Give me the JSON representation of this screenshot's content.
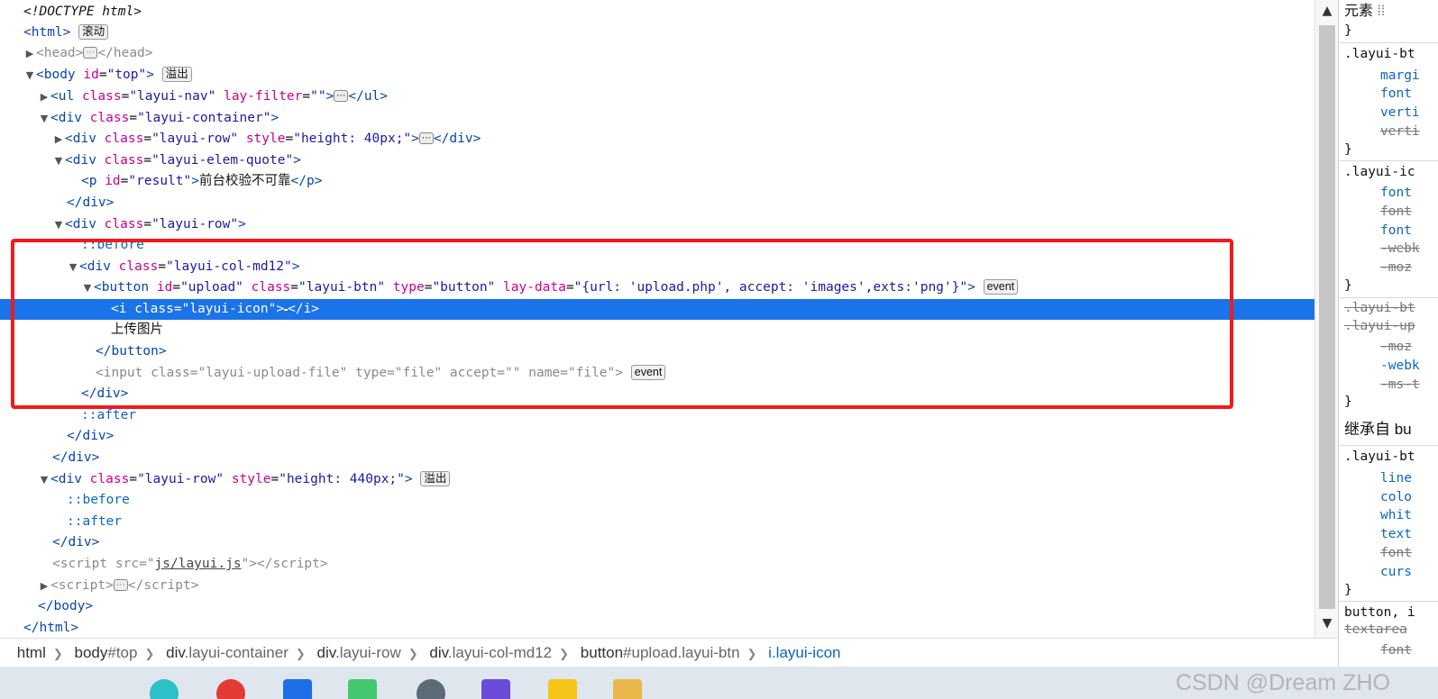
{
  "badges": {
    "scroll": "滚动",
    "overflow": "溢出",
    "event": "event",
    "ellipsis": "⋯"
  },
  "dom": {
    "l1": {
      "text": "<!DOCTYPE html>"
    },
    "l2": {
      "tag": "html"
    },
    "l3": {
      "open": "head",
      "close": "head"
    },
    "l4": {
      "tag": "body",
      "attr": "id",
      "val": "\"top\""
    },
    "l5": {
      "tag": "ul",
      "a1": "class",
      "v1": "\"layui-nav\"",
      "a2": "lay-filter",
      "v2": "\"\"",
      "close": "ul"
    },
    "l6": {
      "tag": "div",
      "a1": "class",
      "v1": "\"layui-container\""
    },
    "l7": {
      "tag": "div",
      "a1": "class",
      "v1": "\"layui-row\"",
      "a2": "style",
      "v2": "\"height: 40px;\"",
      "close": "div"
    },
    "l8": {
      "tag": "div",
      "a1": "class",
      "v1": "\"layui-elem-quote\""
    },
    "l9": {
      "tag": "p",
      "a1": "id",
      "v1": "\"result\"",
      "text": "前台校验不可靠",
      "close": "p"
    },
    "l10": {
      "close": "div"
    },
    "l11": {
      "tag": "div",
      "a1": "class",
      "v1": "\"layui-row\""
    },
    "l12": {
      "text": "::before"
    },
    "l13": {
      "tag": "div",
      "a1": "class",
      "v1": "\"layui-col-md12\""
    },
    "l14": {
      "tag": "button",
      "a1": "id",
      "v1": "\"upload\"",
      "a2": "class",
      "v2": "\"layui-btn\"",
      "a3": "type",
      "v3": "\"button\"",
      "a4": "lay-data",
      "v4": "\"{url: 'upload.php', accept: 'images',exts:'png'}\""
    },
    "l15": {
      "tag": "i",
      "a1": "class",
      "v1": "\"layui-icon\"",
      "glyph": "",
      "close": "i"
    },
    "l16": {
      "text": "上传图片"
    },
    "l17": {
      "close": "button"
    },
    "l18": {
      "tag": "input",
      "a1": "class",
      "v1": "\"layui-upload-file\"",
      "a2": "type",
      "v2": "\"file\"",
      "a3": "accept",
      "v3": "\"\"",
      "a4": "name",
      "v4": "\"file\""
    },
    "l19": {
      "close": "div"
    },
    "l20": {
      "text": "::after"
    },
    "l21": {
      "close": "div"
    },
    "l22": {
      "close": "div"
    },
    "l23": {
      "tag": "div",
      "a1": "class",
      "v1": "\"layui-row\"",
      "a2": "style",
      "v2": "\"height: 440px;\""
    },
    "l24": {
      "text": "::before"
    },
    "l25": {
      "text": "::after"
    },
    "l26": {
      "close": "div"
    },
    "l27": {
      "tag": "script",
      "a1": "src",
      "v1": "js/layui.js",
      "close": "script"
    },
    "l28": {
      "open": "script",
      "close": "script"
    },
    "l29": {
      "close": "body"
    },
    "l30": {
      "close": "html"
    }
  },
  "styles_panel": {
    "tab": "元素",
    "lines": [
      "}",
      ".layui-bt",
      "margi",
      "font",
      "verti",
      "verti",
      "}",
      ".layui-ic",
      "font",
      "font",
      "font",
      "-webk",
      "-moz",
      "}",
      ".layui-bt",
      ".layui-up",
      "-moz",
      "-webk",
      "-ms-t",
      "}",
      "继承自 bu",
      ".layui-bt",
      "line",
      "colo",
      "whit",
      "text",
      "font",
      "curs",
      "}",
      "button, i",
      "textarea",
      "font"
    ]
  },
  "breadcrumbs": [
    {
      "tag": "html",
      "cls": ""
    },
    {
      "tag": "body",
      "cls": "#top"
    },
    {
      "tag": "div",
      "cls": ".layui-container"
    },
    {
      "tag": "div",
      "cls": ".layui-row"
    },
    {
      "tag": "div",
      "cls": ".layui-col-md12"
    },
    {
      "tag": "button",
      "cls": "#upload.layui-btn"
    },
    {
      "tag": "i",
      "cls": ".layui-icon"
    }
  ],
  "watermark": "CSDN @Dream ZHO"
}
